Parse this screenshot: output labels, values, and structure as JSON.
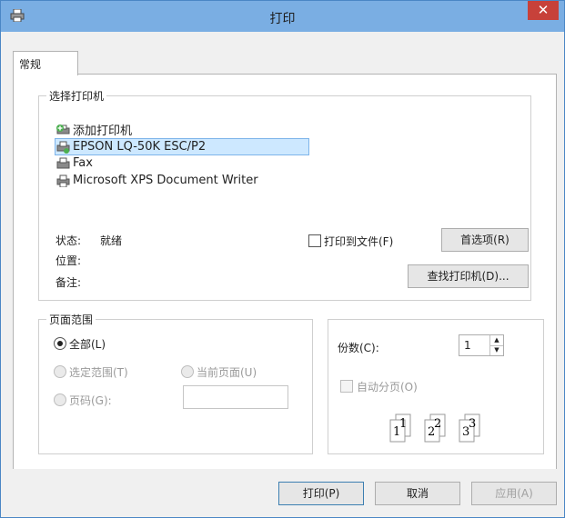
{
  "window": {
    "title": "打印",
    "close_glyph": "✕"
  },
  "tabs": [
    {
      "label": "常规"
    }
  ],
  "select_printer": {
    "legend": "选择打印机",
    "printers": [
      {
        "label": "添加打印机",
        "icon": "add-printer-icon",
        "selected": false
      },
      {
        "label": "EPSON LQ-50K ESC/P2",
        "icon": "printer-icon",
        "selected": true
      },
      {
        "label": "Fax",
        "icon": "fax-icon",
        "selected": false
      },
      {
        "label": "Microsoft XPS Document Writer",
        "icon": "printer-icon",
        "selected": false
      }
    ],
    "status_label": "状态:",
    "status_value": "就绪",
    "location_label": "位置:",
    "comment_label": "备注:",
    "print_to_file": "打印到文件(F)",
    "preferences_button": "首选项(R)",
    "find_printer_button": "查找打印机(D)..."
  },
  "page_range": {
    "legend": "页面范围",
    "all": "全部(L)",
    "selection": "选定范围(T)",
    "current_page": "当前页面(U)",
    "pages": "页码(G):",
    "pages_value": ""
  },
  "copies": {
    "label": "份数(C):",
    "value": "1",
    "collate": "自动分页(O)",
    "collate_pages": [
      "1",
      "1",
      "2",
      "2",
      "3",
      "3"
    ]
  },
  "buttons": {
    "print": "打印(P)",
    "cancel": "取消",
    "apply": "应用(A)"
  },
  "colors": {
    "titlebar": "#7aaee3",
    "close": "#c7413a",
    "selection": "#cde8ff"
  }
}
